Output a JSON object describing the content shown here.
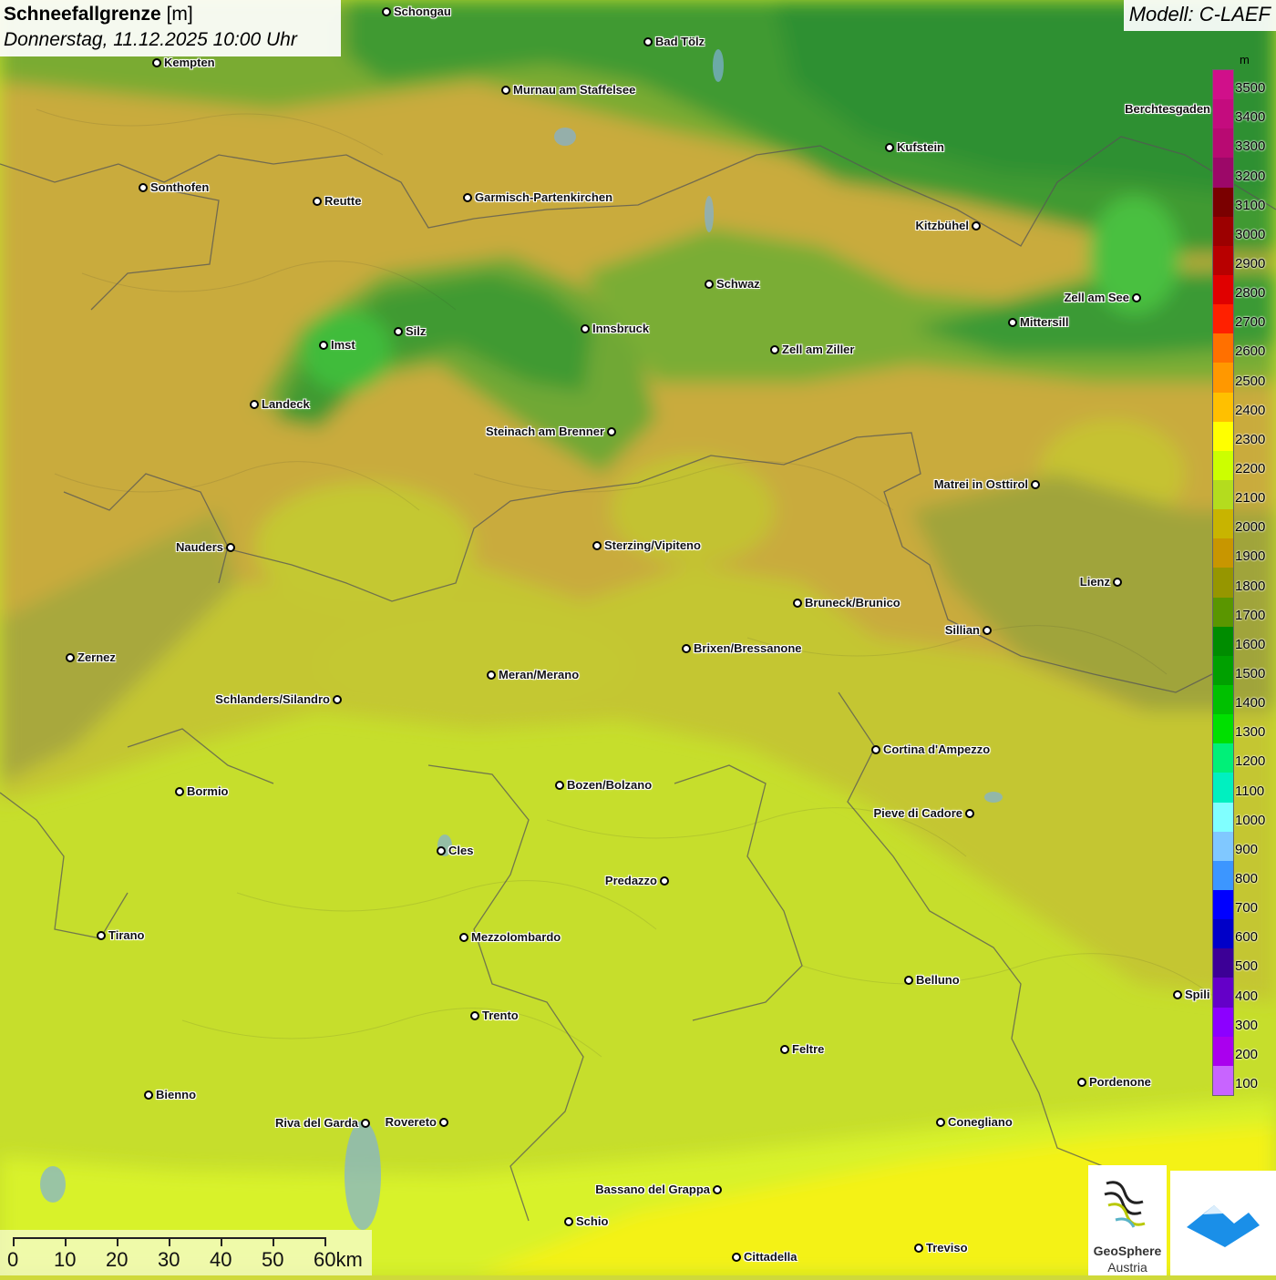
{
  "title": {
    "param": "Schneefallgrenze",
    "unit": "[m]",
    "datetime": "Donnerstag, 11.12.2025 10:00 Uhr"
  },
  "model": "Modell: C-LAEF",
  "legend": {
    "unit": "m",
    "classes": [
      {
        "label": "3500",
        "color": "#d0108a"
      },
      {
        "label": "3400",
        "color": "#c40c7e"
      },
      {
        "label": "3300",
        "color": "#b80a72"
      },
      {
        "label": "3200",
        "color": "#9c0868"
      },
      {
        "label": "3100",
        "color": "#7a0000"
      },
      {
        "label": "3000",
        "color": "#9c0000"
      },
      {
        "label": "2900",
        "color": "#b80000"
      },
      {
        "label": "2800",
        "color": "#e00000"
      },
      {
        "label": "2700",
        "color": "#ff2000"
      },
      {
        "label": "2600",
        "color": "#ff7000"
      },
      {
        "label": "2500",
        "color": "#ff9800"
      },
      {
        "label": "2400",
        "color": "#ffc000"
      },
      {
        "label": "2300",
        "color": "#ffff00"
      },
      {
        "label": "2200",
        "color": "#ccff00"
      },
      {
        "label": "2100",
        "color": "#b4dc1e"
      },
      {
        "label": "2000",
        "color": "#c8b400"
      },
      {
        "label": "1900",
        "color": "#c89600"
      },
      {
        "label": "1800",
        "color": "#969600"
      },
      {
        "label": "1700",
        "color": "#5a9600"
      },
      {
        "label": "1600",
        "color": "#008c00"
      },
      {
        "label": "1500",
        "color": "#00a000"
      },
      {
        "label": "1400",
        "color": "#00c000"
      },
      {
        "label": "1300",
        "color": "#00e000"
      },
      {
        "label": "1200",
        "color": "#00f078"
      },
      {
        "label": "1100",
        "color": "#00f0c0"
      },
      {
        "label": "1000",
        "color": "#80ffff"
      },
      {
        "label": "900",
        "color": "#80c8ff"
      },
      {
        "label": "800",
        "color": "#3c96ff"
      },
      {
        "label": "700",
        "color": "#0000ff"
      },
      {
        "label": "600",
        "color": "#0000c8"
      },
      {
        "label": "500",
        "color": "#3c0096"
      },
      {
        "label": "400",
        "color": "#6400c8"
      },
      {
        "label": "300",
        "color": "#8c00ff"
      },
      {
        "label": "200",
        "color": "#aa00ee"
      },
      {
        "label": "100",
        "color": "#c864ff"
      }
    ]
  },
  "cities": [
    {
      "name": "Schongau",
      "label_side": "right"
    },
    {
      "name": "Bad Tölz",
      "label_side": "right"
    },
    {
      "name": "Kempten",
      "label_side": "right"
    },
    {
      "name": "Murnau am Staffelsee",
      "label_side": "right"
    },
    {
      "name": "Berchtesgaden",
      "label_side": "left"
    },
    {
      "name": "Kufstein",
      "label_side": "right"
    },
    {
      "name": "Sonthofen",
      "label_side": "right"
    },
    {
      "name": "Reutte",
      "label_side": "right"
    },
    {
      "name": "Garmisch-Partenkirchen",
      "label_side": "right"
    },
    {
      "name": "Kitzbühel",
      "label_side": "left"
    },
    {
      "name": "Schwaz",
      "label_side": "right"
    },
    {
      "name": "Zell am See",
      "label_side": "left"
    },
    {
      "name": "Innsbruck",
      "label_side": "right"
    },
    {
      "name": "Mittersill",
      "label_side": "right"
    },
    {
      "name": "Imst",
      "label_side": "right"
    },
    {
      "name": "Silz",
      "label_side": "right"
    },
    {
      "name": "Zell am Ziller",
      "label_side": "right"
    },
    {
      "name": "Landeck",
      "label_side": "right"
    },
    {
      "name": "Steinach am Brenner",
      "label_side": "left"
    },
    {
      "name": "Matrei in Osttirol",
      "label_side": "left"
    },
    {
      "name": "Nauders",
      "label_side": "left"
    },
    {
      "name": "Sterzing/Vipiteno",
      "label_side": "right"
    },
    {
      "name": "Lienz",
      "label_side": "left"
    },
    {
      "name": "Bruneck/Brunico",
      "label_side": "right"
    },
    {
      "name": "Sillian",
      "label_side": "left"
    },
    {
      "name": "Brixen/Bressanone",
      "label_side": "right"
    },
    {
      "name": "Zernez",
      "label_side": "right"
    },
    {
      "name": "Meran/Merano",
      "label_side": "right"
    },
    {
      "name": "Schlanders/Silandro",
      "label_side": "left"
    },
    {
      "name": "Cortina d'Ampezzo",
      "label_side": "right"
    },
    {
      "name": "Bozen/Bolzano",
      "label_side": "right"
    },
    {
      "name": "Bormio",
      "label_side": "right"
    },
    {
      "name": "Pieve di Cadore",
      "label_side": "left"
    },
    {
      "name": "Cles",
      "label_side": "right"
    },
    {
      "name": "Predazzo",
      "label_side": "left"
    },
    {
      "name": "Tirano",
      "label_side": "right"
    },
    {
      "name": "Mezzolombardo",
      "label_side": "right"
    },
    {
      "name": "Belluno",
      "label_side": "right"
    },
    {
      "name": "Spili",
      "label_side": "right"
    },
    {
      "name": "Trento",
      "label_side": "right"
    },
    {
      "name": "Feltre",
      "label_side": "right"
    },
    {
      "name": "Pordenone",
      "label_side": "right"
    },
    {
      "name": "Bienno",
      "label_side": "right"
    },
    {
      "name": "Riva del Garda",
      "label_side": "left"
    },
    {
      "name": "Rovereto",
      "label_side": "left"
    },
    {
      "name": "Conegliano",
      "label_side": "right"
    },
    {
      "name": "Bassano del Grappa",
      "label_side": "left"
    },
    {
      "name": "Schio",
      "label_side": "right"
    },
    {
      "name": "Treviso",
      "label_side": "right"
    },
    {
      "name": "Cittadella",
      "label_side": "right"
    }
  ],
  "scale": {
    "labels": [
      "0",
      "10",
      "20",
      "30",
      "40",
      "50",
      "60km"
    ]
  },
  "logos": {
    "geosphere_line1": "GeoSphere",
    "geosphere_line2": "Austria"
  }
}
